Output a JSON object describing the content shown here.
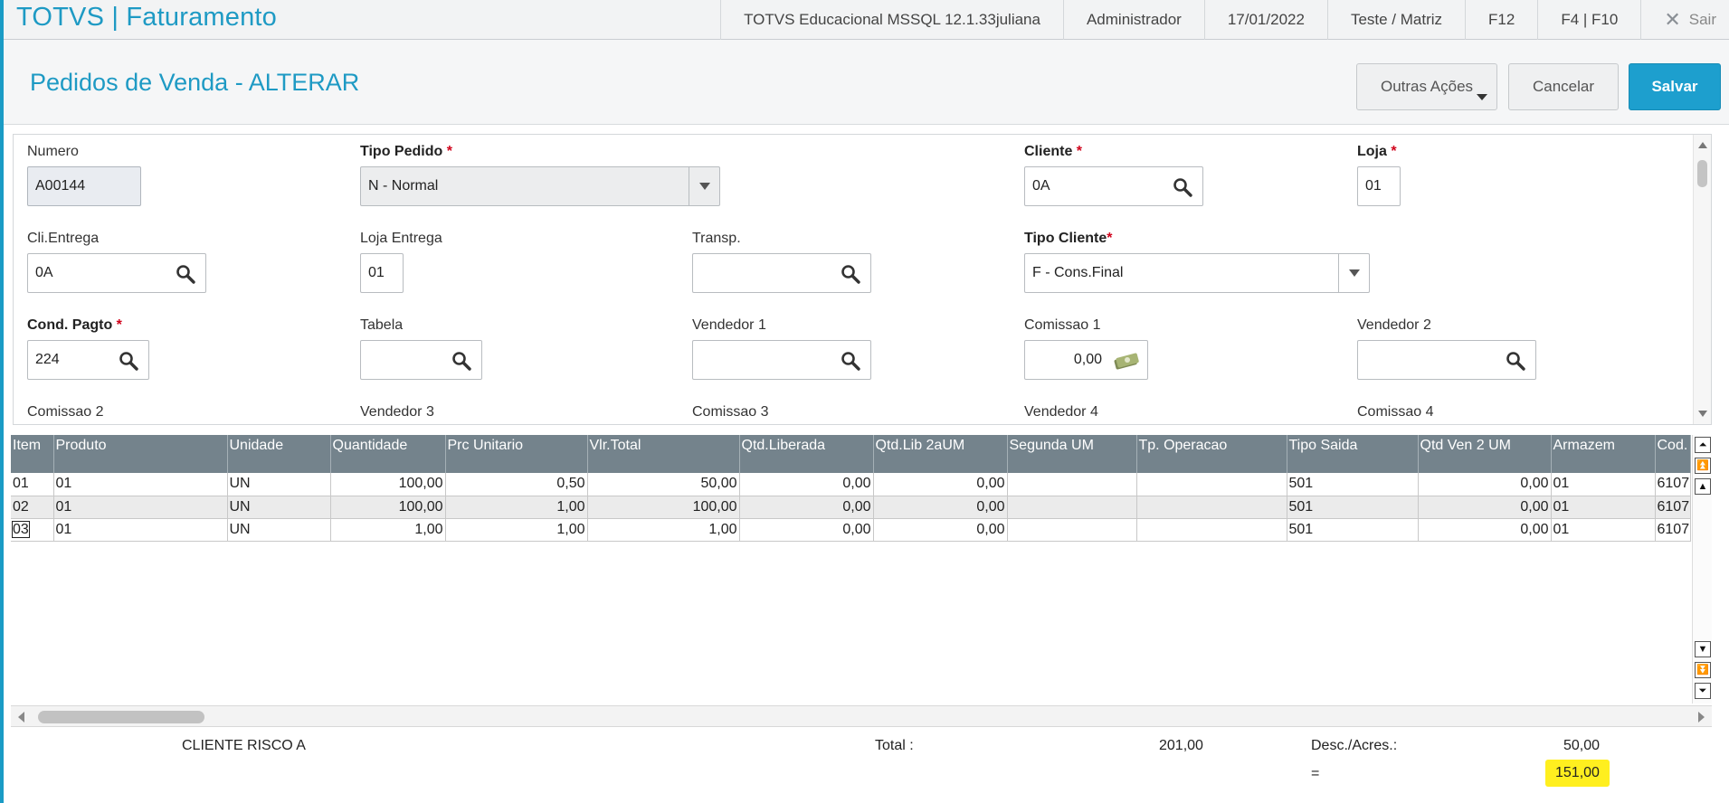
{
  "topbar": {
    "app_title": "TOTVS | Faturamento",
    "environment": "TOTVS Educacional MSSQL 12.1.33juliana",
    "user": "Administrador",
    "date": "17/01/2022",
    "branch": "Teste / Matriz",
    "shortcut_f12": "F12",
    "shortcut_f4_f10": "F4 | F10",
    "exit_label": "Sair"
  },
  "header": {
    "page_title": "Pedidos de Venda - ALTERAR",
    "outras_acoes_label": "Outras Ações",
    "cancel_label": "Cancelar",
    "save_label": "Salvar"
  },
  "form": {
    "numero": {
      "label": "Numero",
      "value": "A00144"
    },
    "tipo_pedido": {
      "label": "Tipo Pedido",
      "value": "N - Normal"
    },
    "cliente": {
      "label": "Cliente",
      "value": "0A"
    },
    "loja": {
      "label": "Loja",
      "value": "01"
    },
    "cli_entrega": {
      "label": "Cli.Entrega",
      "value": "0A"
    },
    "loja_entrega": {
      "label": "Loja Entrega",
      "value": "01"
    },
    "transp": {
      "label": "Transp.",
      "value": ""
    },
    "tipo_cliente": {
      "label": "Tipo Cliente",
      "value": "F - Cons.Final"
    },
    "cond_pagto": {
      "label": "Cond. Pagto",
      "value": "224"
    },
    "tabela": {
      "label": "Tabela",
      "value": ""
    },
    "vendedor1": {
      "label": "Vendedor 1",
      "value": ""
    },
    "comissao1": {
      "label": "Comissao 1",
      "value": "0,00"
    },
    "vendedor2": {
      "label": "Vendedor 2",
      "value": ""
    },
    "comissao2": {
      "label": "Comissao 2"
    },
    "vendedor3": {
      "label": "Vendedor 3"
    },
    "comissao3": {
      "label": "Comissao 3"
    },
    "vendedor4": {
      "label": "Vendedor 4"
    },
    "comissao4": {
      "label": "Comissao 4"
    },
    "required_mark": "*"
  },
  "grid": {
    "columns": [
      "Item",
      "Produto",
      "Unidade",
      "Quantidade",
      "Prc Unitario",
      "Vlr.Total",
      "Qtd.Liberada",
      "Qtd.Lib 2aUM",
      "Segunda UM",
      "Tp. Operacao",
      "Tipo Saida",
      "Qtd Ven 2 UM",
      "Armazem",
      "Cod. F"
    ],
    "rows": [
      [
        "01",
        "01",
        "UN",
        "100,00",
        "0,50",
        "50,00",
        "0,00",
        "0,00",
        "",
        "",
        "501",
        "0,00",
        "01",
        "6107"
      ],
      [
        "02",
        "01",
        "UN",
        "100,00",
        "1,00",
        "100,00",
        "0,00",
        "0,00",
        "",
        "",
        "501",
        "0,00",
        "01",
        "6107"
      ],
      [
        "03",
        "01",
        "UN",
        "1,00",
        "1,00",
        "1,00",
        "0,00",
        "0,00",
        "",
        "",
        "501",
        "0,00",
        "01",
        "6107"
      ]
    ]
  },
  "footer": {
    "client_risk": "CLIENTE RISCO A",
    "total_label": "Total :",
    "total_value": "201,00",
    "desc_label": "Desc./Acres.:",
    "desc_value": "50,00",
    "equals_label": "=",
    "final_value": "151,00",
    "highlight_color": "#ffef1f"
  },
  "colors": {
    "accent": "#1e9ac4",
    "grid_header": "#74838c",
    "required": "#d0021b"
  }
}
